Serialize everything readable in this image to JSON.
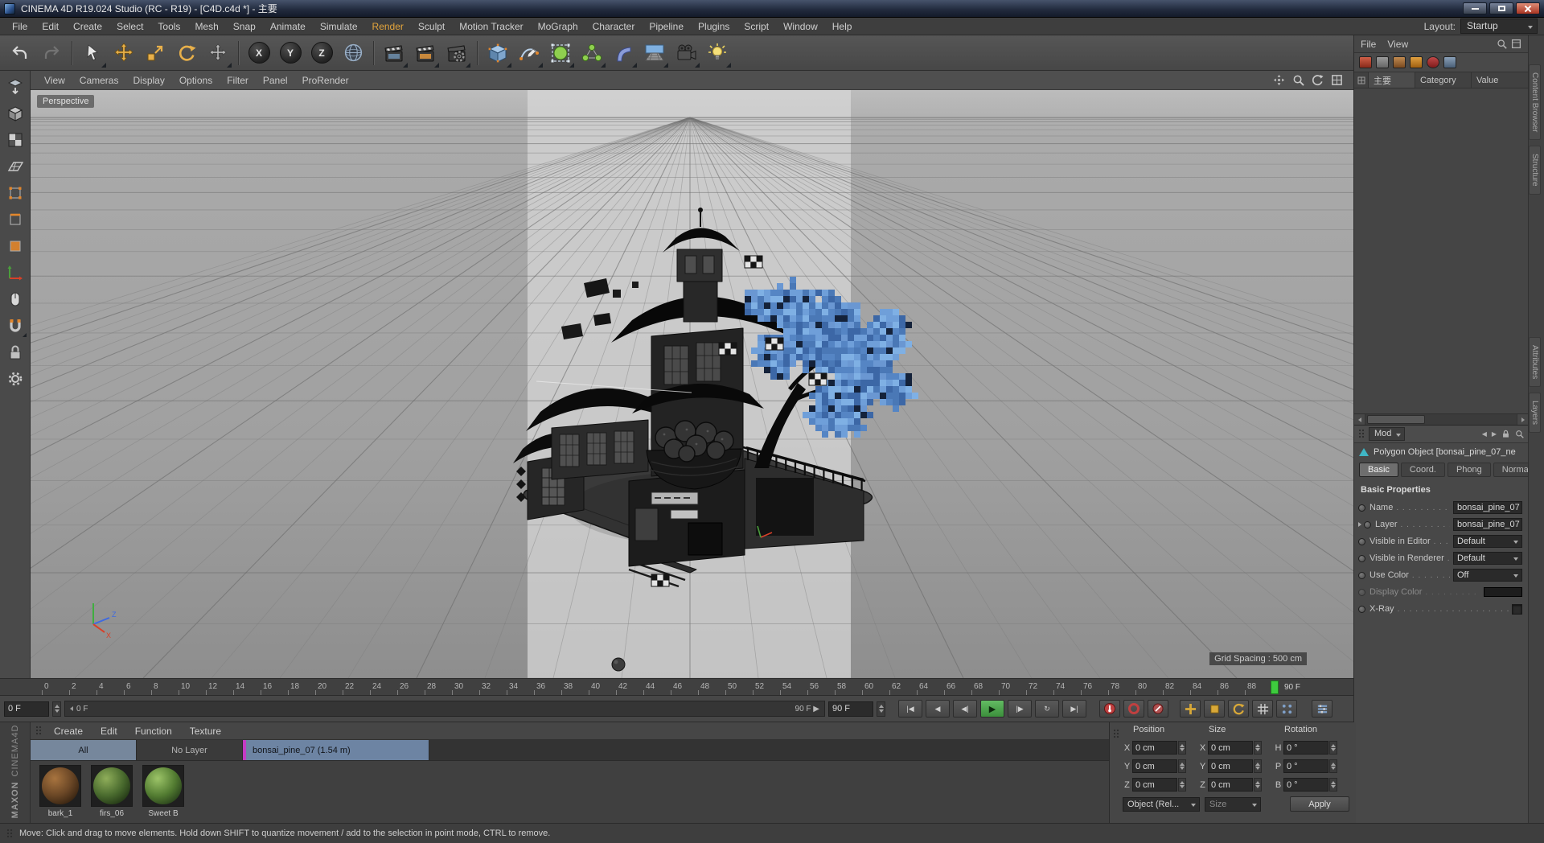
{
  "window": {
    "title": "CINEMA 4D R19.024 Studio (RC - R19) - [C4D.c4d *] - 主要"
  },
  "menubar": {
    "items": [
      {
        "label": "File"
      },
      {
        "label": "Edit"
      },
      {
        "label": "Create"
      },
      {
        "label": "Select"
      },
      {
        "label": "Tools"
      },
      {
        "label": "Mesh"
      },
      {
        "label": "Snap"
      },
      {
        "label": "Animate"
      },
      {
        "label": "Simulate"
      },
      {
        "label": "Render",
        "active": true
      },
      {
        "label": "Sculpt"
      },
      {
        "label": "Motion Tracker"
      },
      {
        "label": "MoGraph"
      },
      {
        "label": "Character"
      },
      {
        "label": "Pipeline"
      },
      {
        "label": "Plugins"
      },
      {
        "label": "Script"
      },
      {
        "label": "Window"
      },
      {
        "label": "Help"
      }
    ],
    "layout_label": "Layout:",
    "layout_value": "Startup"
  },
  "toolbar": {
    "axis_buttons": [
      "X",
      "Y",
      "Z"
    ]
  },
  "viewport": {
    "menu": [
      "View",
      "Cameras",
      "Display",
      "Options",
      "Filter",
      "Panel",
      "ProRender"
    ],
    "camera_label": "Perspective",
    "grid_spacing_label": "Grid Spacing : 500 cm",
    "axis_x": "X",
    "axis_z": "Z"
  },
  "object_manager": {
    "menu": [
      "File",
      "View"
    ],
    "bookmark_tab": "主要",
    "columns": [
      "Category",
      "Value"
    ]
  },
  "attribute_manager": {
    "mode_label": "Mod",
    "object_title": "Polygon Object [bonsai_pine_07_ne",
    "tabs": [
      {
        "label": "Basic",
        "active": true
      },
      {
        "label": "Coord."
      },
      {
        "label": "Phong"
      },
      {
        "label": "Normal"
      }
    ],
    "section_title": "Basic Properties",
    "fields": {
      "name_label": "Name",
      "name_value": "bonsai_pine_07",
      "layer_label": "Layer",
      "layer_value": "bonsai_pine_07",
      "visible_editor_label": "Visible in Editor",
      "visible_editor_value": "Default",
      "visible_renderer_label": "Visible in Renderer",
      "visible_renderer_value": "Default",
      "use_color_label": "Use Color",
      "use_color_value": "Off",
      "display_color_label": "Display Color",
      "xray_label": "X-Ray"
    }
  },
  "side_tabs": {
    "top": [
      "Content Browser",
      "Structure"
    ],
    "bottom": [
      "Attributes",
      "Layers"
    ]
  },
  "timeline": {
    "ticks": [
      "0",
      "2",
      "4",
      "6",
      "8",
      "10",
      "12",
      "14",
      "16",
      "18",
      "20",
      "22",
      "24",
      "26",
      "28",
      "30",
      "32",
      "34",
      "36",
      "38",
      "40",
      "42",
      "44",
      "46",
      "48",
      "50",
      "52",
      "54",
      "56",
      "58",
      "60",
      "62",
      "64",
      "66",
      "68",
      "70",
      "72",
      "74",
      "76",
      "78",
      "80",
      "82",
      "84",
      "86",
      "88"
    ],
    "playhead_label": "90 F",
    "start_field": "0 F",
    "range_start": "0 F",
    "range_end": "90 F ▶",
    "end_field": "90 F"
  },
  "transport": {
    "go_start": "|◀",
    "play_back": "◀",
    "prev_frame": "◀|",
    "play": "▶",
    "next_frame": "|▶",
    "loop": "↻",
    "go_end": "▶|"
  },
  "materials": {
    "menu": [
      "Create",
      "Edit",
      "Function",
      "Texture"
    ],
    "layer_tabs": {
      "all": "All",
      "no_layer": "No Layer",
      "bonsai": "bonsai_pine_07  (1.54 m)"
    },
    "items": [
      {
        "name": "bark_1"
      },
      {
        "name": "firs_06"
      },
      {
        "name": "Sweet B"
      }
    ]
  },
  "coordinates": {
    "headers": [
      "Position",
      "Size",
      "Rotation"
    ],
    "labels": {
      "p0": "X",
      "p1": "Y",
      "p2": "Z",
      "s0": "X",
      "s1": "Y",
      "s2": "Z",
      "r0": "H",
      "r1": "P",
      "r2": "B"
    },
    "position": {
      "x": "0 cm",
      "y": "0 cm",
      "z": "0 cm"
    },
    "size": {
      "x": "0 cm",
      "y": "0 cm",
      "z": "0 cm"
    },
    "rotation": {
      "h": "0 °",
      "p": "0 °",
      "b": "0 °"
    },
    "object_mode": "Object (Rel...",
    "size_mode": "Size",
    "apply_label": "Apply"
  },
  "status_bar": {
    "text": "Move: Click and drag to move elements. Hold down SHIFT to quantize movement / add to the selection in point mode, CTRL to remove."
  },
  "branding": {
    "maxon": "MAXON",
    "cinema": "CINEMA4D"
  },
  "colors": {
    "accent_orange": "#e2a43c",
    "selection_blue": "#6e87a6",
    "playhead_green": "#3ecb3e",
    "tree_blue": "#5c8ecb"
  }
}
